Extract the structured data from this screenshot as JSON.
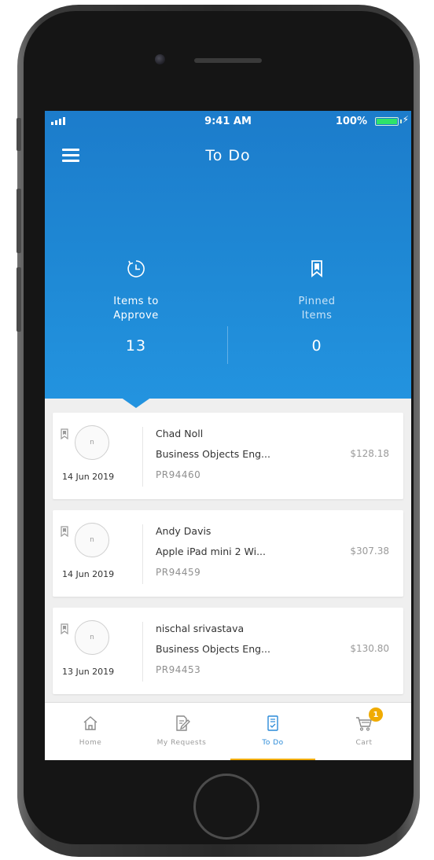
{
  "status_bar": {
    "time": "9:41 AM",
    "battery": "100%"
  },
  "header": {
    "title": "To Do"
  },
  "stats": {
    "approve": {
      "label_line1": "Items to",
      "label_line2": "Approve",
      "count": "13",
      "icon": "clock-icon"
    },
    "pinned": {
      "label_line1": "Pinned",
      "label_line2": "Items",
      "count": "0",
      "icon": "bookmark-icon"
    }
  },
  "items": [
    {
      "avatar": "n",
      "date": "14 Jun 2019",
      "name": "Chad Noll",
      "description": "Business Objects Eng...",
      "amount": "$128.18",
      "id": "PR94460"
    },
    {
      "avatar": "n",
      "date": "14 Jun 2019",
      "name": "Andy Davis",
      "description": "Apple iPad mini 2 Wi...",
      "amount": "$307.38",
      "id": "PR94459"
    },
    {
      "avatar": "n",
      "date": "13 Jun 2019",
      "name": "nischal srivastava",
      "description": "Business Objects Eng...",
      "amount": "$130.80",
      "id": "PR94453"
    }
  ],
  "tabs": [
    {
      "label": "Home",
      "icon": "home-icon"
    },
    {
      "label": "My Requests",
      "icon": "edit-icon"
    },
    {
      "label": "To Do",
      "icon": "checklist-icon",
      "active": true
    },
    {
      "label": "Cart",
      "icon": "cart-icon",
      "badge": "1"
    }
  ],
  "colors": {
    "header_blue": "#1f8ad6",
    "accent_orange": "#f0ab00",
    "active_tab": "#2a8ad8"
  }
}
